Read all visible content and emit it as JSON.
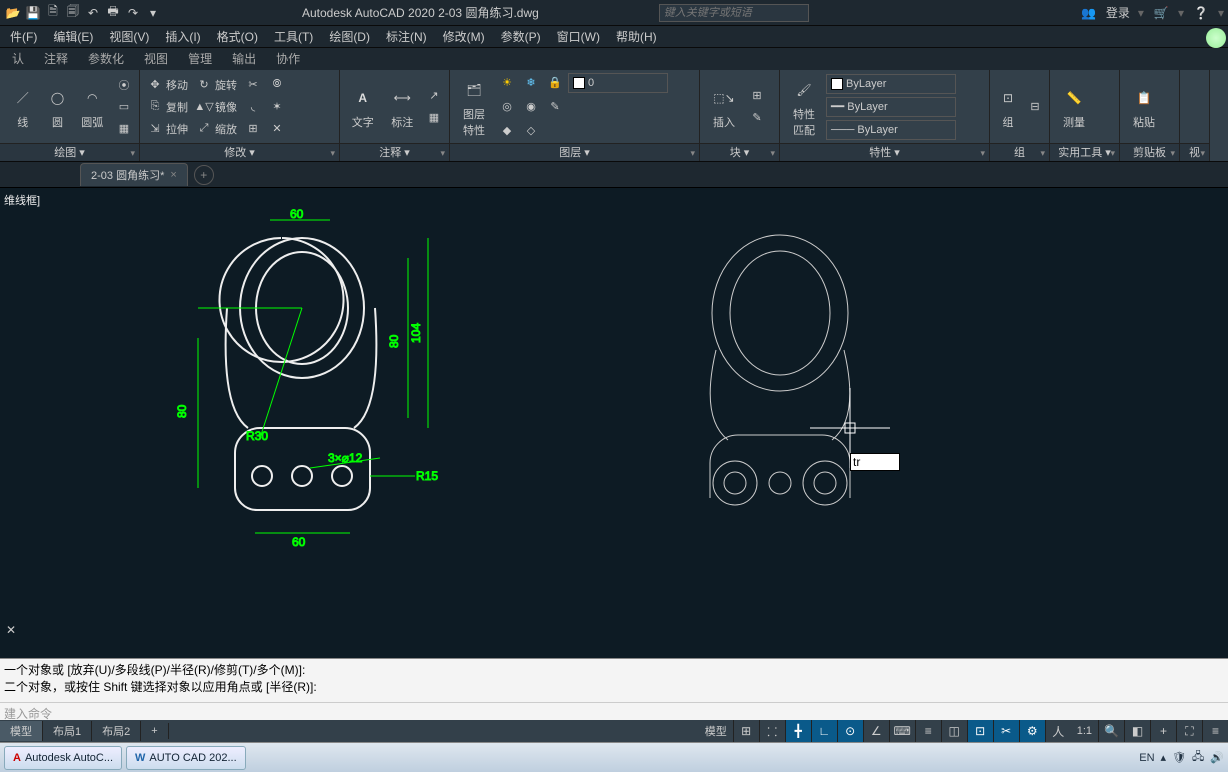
{
  "app": {
    "title": "Autodesk AutoCAD 2020   2-03 圆角练习.dwg",
    "search_ph": "键入关键字或短语",
    "login": "登录"
  },
  "menu": [
    "件(F)",
    "编辑(E)",
    "视图(V)",
    "插入(I)",
    "格式(O)",
    "工具(T)",
    "绘图(D)",
    "标注(N)",
    "修改(M)",
    "参数(P)",
    "窗口(W)",
    "帮助(H)"
  ],
  "rtabs": [
    "认",
    "注释",
    "参数化",
    "视图",
    "管理",
    "输出",
    "协作"
  ],
  "ribbon": {
    "draw": {
      "label": "绘图 ▾",
      "line": "线",
      "circle": "圆",
      "arc": "圆弧"
    },
    "modify": {
      "label": "修改 ▾",
      "move": "移动",
      "rotate": "旋转",
      "copy": "复制",
      "mirror": "镜像",
      "stretch": "拉伸",
      "scale": "缩放"
    },
    "annot": {
      "label": "注释 ▾",
      "text": "文字",
      "dim": "标注"
    },
    "layer": {
      "label": "图层 ▾",
      "props": "图层\n特性"
    },
    "block": {
      "label": "块 ▾",
      "insert": "插入"
    },
    "prop": {
      "label": "特性 ▾",
      "match": "特性\n匹配",
      "bylayer": "ByLayer"
    },
    "group": {
      "label": "组",
      "g": "组"
    },
    "util": {
      "label": "实用工具 ▾",
      "measure": "测量"
    },
    "clip": {
      "label": "剪贴板",
      "paste": "粘贴"
    },
    "view": {
      "label": "视"
    }
  },
  "filetab": {
    "name": "2-03 圆角练习*"
  },
  "viewport_label": "维线框]",
  "dims": {
    "top": "60",
    "bottom": "60",
    "left": "80",
    "r30": "R30",
    "holes": "3×⌀12",
    "r15": "R15",
    "h80": "80",
    "h104": "104"
  },
  "cmd": {
    "line1": "一个对象或 [放弃(U)/多段线(P)/半径(R)/修剪(T)/多个(M)]:",
    "line2": "二个对象，或按住 Shift 键选择对象以应用角点或 [半径(R)]:",
    "prompt": "建入命令",
    "input": "tr"
  },
  "layouts": [
    "模型",
    "布局1",
    "布局2"
  ],
  "status": {
    "model": "模型",
    "scale": "1:1"
  },
  "taskbar": {
    "app1": "Autodesk AutoC...",
    "app2": "AUTO  CAD 202...",
    "ime": "EN"
  }
}
